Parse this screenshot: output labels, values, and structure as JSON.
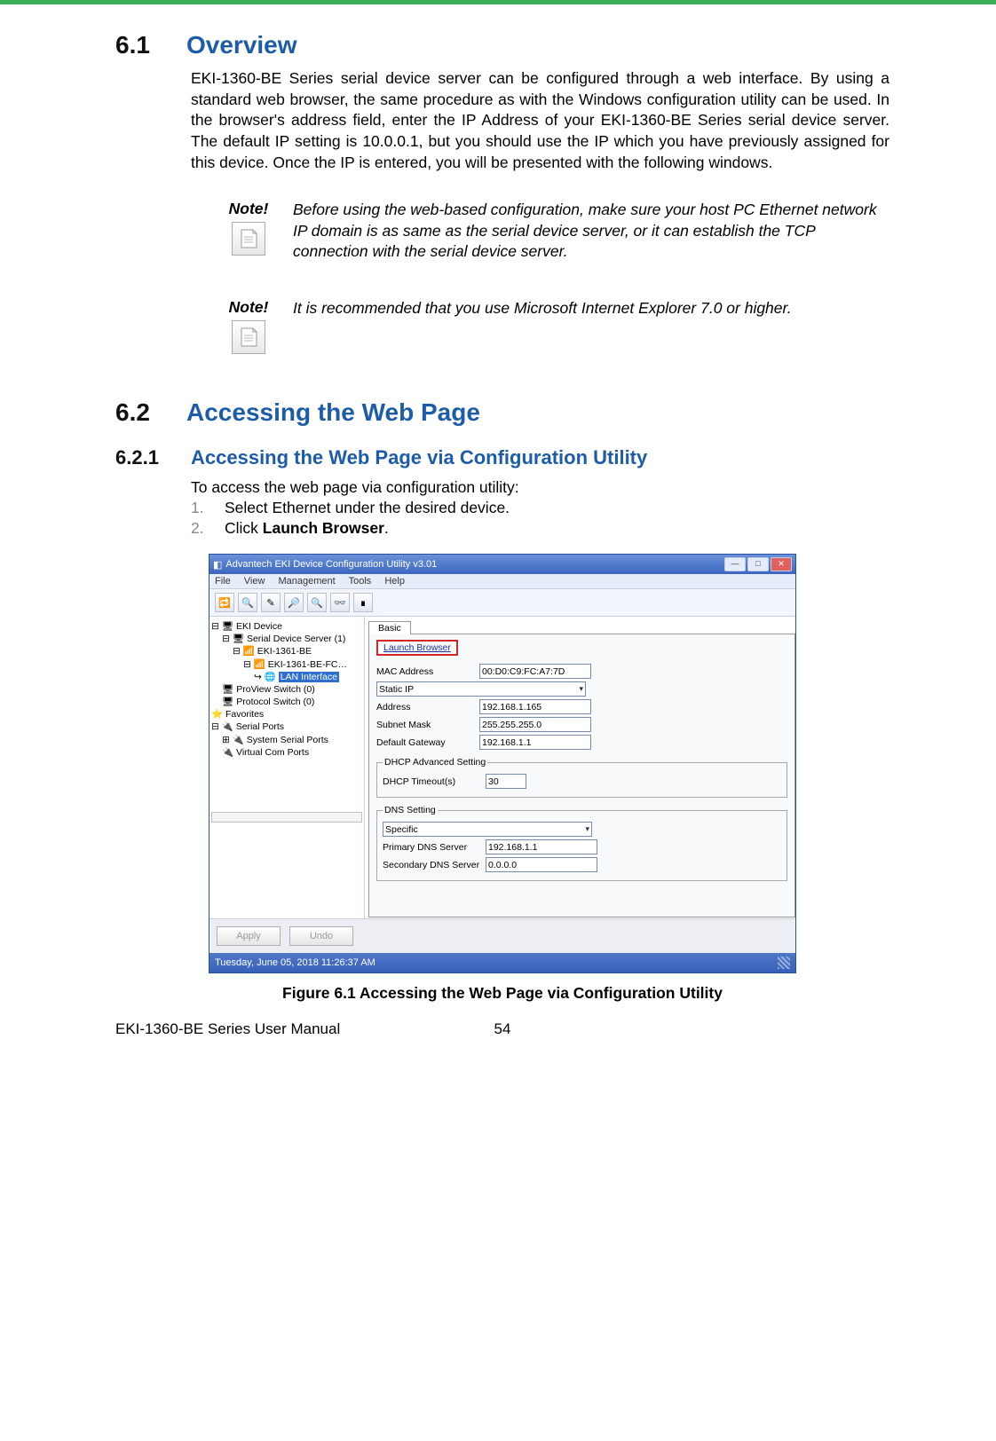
{
  "s61": {
    "num": "6.1",
    "title": "Overview",
    "body": "EKI-1360-BE Series serial device server can be configured through a web interface. By using a standard web browser, the same procedure as with the Windows configuration utility can be used. In the browser's address field, enter the IP Address of your EKI-1360-BE Series serial device server. The default IP setting is 10.0.0.1, but you should use the IP which you have previously assigned for this device. Once the IP is entered, you will be presented with the following windows."
  },
  "notes": [
    {
      "label": "Note!",
      "text": "Before using the web-based configuration, make sure your host PC Ethernet network IP domain is as same as the serial device server, or it can establish the TCP connection with the serial device server."
    },
    {
      "label": "Note!",
      "text": "It is recommended that you use Microsoft Internet Explorer 7.0 or higher."
    }
  ],
  "s62": {
    "num": "6.2",
    "title": "Accessing the Web Page"
  },
  "s621": {
    "num": "6.2.1",
    "title": "Accessing the Web Page via Configuration Utility",
    "intro": "To access the web page via configuration utility:",
    "steps": [
      {
        "n": "1.",
        "t": "Select Ethernet under the desired device."
      },
      {
        "n": "2.",
        "t1": "Click ",
        "t2": "Launch Browser",
        "t3": "."
      }
    ]
  },
  "shot": {
    "title": "Advantech EKI Device Configuration Utility v3.01",
    "menu": [
      "File",
      "View",
      "Management",
      "Tools",
      "Help"
    ],
    "tree": [
      "EKI Device",
      "Serial Device Server (1)",
      "EKI-1361-BE",
      "EKI-1361-BE-FC…",
      "LAN Interface",
      "ProView Switch (0)",
      "Protocol Switch (0)",
      "Favorites",
      "Serial Ports",
      "System Serial Ports",
      "Virtual Com Ports"
    ],
    "tab": "Basic",
    "launch": "Launch Browser",
    "fields": {
      "mac": {
        "l": "MAC Address",
        "v": "00:D0:C9:FC:A7:7D"
      },
      "ipmode": "Static IP",
      "addr": {
        "l": "Address",
        "v": "192.168.1.165"
      },
      "mask": {
        "l": "Subnet Mask",
        "v": "255.255.255.0"
      },
      "gw": {
        "l": "Default Gateway",
        "v": "192.168.1.1"
      }
    },
    "dhcp": {
      "legend": "DHCP Advanced Setting",
      "l": "DHCP Timeout(s)",
      "v": "30"
    },
    "dns": {
      "legend": "DNS Setting",
      "mode": "Specific",
      "p": {
        "l": "Primary DNS Server",
        "v": "192.168.1.1"
      },
      "s": {
        "l": "Secondary DNS Server",
        "v": "0.0.0.0"
      }
    },
    "buttons": [
      "Apply",
      "Undo"
    ],
    "status": "Tuesday, June 05, 2018  11:26:37 AM"
  },
  "figure": {
    "caption": "Figure 6.1 Accessing the Web Page via Configuration Utility"
  },
  "footer": {
    "manual": "EKI-1360-BE Series User Manual",
    "page": "54"
  }
}
